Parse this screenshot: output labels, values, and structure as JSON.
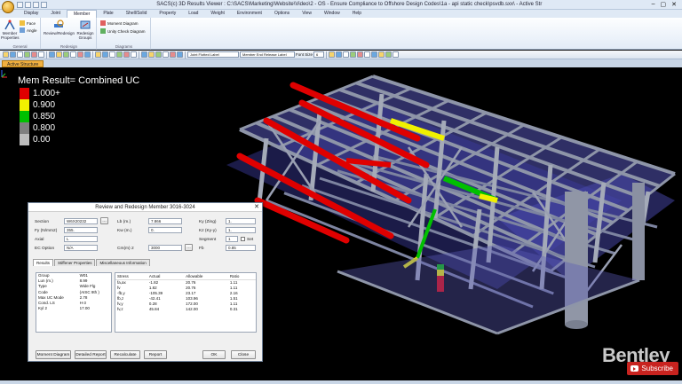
{
  "window": {
    "title": "SACS(c) 3D Results Viewer :  C:\\SACS\\Marketing\\Website\\Video\\2 - OS - Ensure Compliance to Offshore Design Codes\\1a - api static check\\psvdb.sxx\\ - Active Str",
    "controls": [
      "–",
      "▢",
      "✕"
    ]
  },
  "ribbon_tabs": [
    "Display",
    "Joint",
    "Member",
    "Plate",
    "Shell/Solid",
    "Property",
    "Load",
    "Weight",
    "Environment",
    "Options",
    "View",
    "Window",
    "Help"
  ],
  "ribbon_active_tab": "Member",
  "ribbon": {
    "general": {
      "label": "General",
      "member_properties": "Member Properties",
      "face": "Face",
      "angle": "Angle"
    },
    "redesign": {
      "label": "Redesign",
      "review_redesign": "Review/Redesign",
      "redesign_member": "Redesign Groups"
    },
    "diagrams": {
      "label": "Diagrams",
      "moment_diagram": "Moment Diagram",
      "unity_check_diagram": "Unity Check Diagram"
    }
  },
  "toolbar": {
    "dropdown1": "Joint Flotted Label",
    "dropdown2": "Member End Release Label",
    "font_label": "Font Size",
    "font_size": "6"
  },
  "doc_tab": "Active Structure",
  "legend": {
    "title": "Mem Result= Combined UC",
    "items": [
      {
        "label": "1.000+",
        "color": "#e00000"
      },
      {
        "label": "0.900",
        "color": "#f0f000"
      },
      {
        "label": "0.850",
        "color": "#00c000"
      },
      {
        "label": "0.800",
        "color": "#808080"
      },
      {
        "label": "0.00",
        "color": "#bdbdbd"
      }
    ]
  },
  "brand": {
    "name": "Bentley",
    "tag": "Advancing In"
  },
  "subscribe": "Subscribe",
  "dialog": {
    "title": "Review and Redesign Member 3016-3024",
    "close": "✕",
    "fields": {
      "section_label": "Section",
      "section_value": "W6X20232",
      "fy_label": "Fy (N/mm2)",
      "fy_value": "355.",
      "axial_label": "Axial",
      "axial_value": "L",
      "ec_option_label": "EC Option",
      "ec_option_value": "N/A",
      "lb_label": "Lb (m.)",
      "lb_value": "7.866",
      "kw_label": "Kw (m.)",
      "kw_value": "0.",
      "cm_label": "Cm(m) 2",
      "cm_value": "3000",
      "ky_label": "Ky (Zing)",
      "ky_value": "1.",
      "kz_label": "Kz (Ky-y)",
      "kz_value": "1.",
      "segment_label": "Segment",
      "segment_value": "1",
      "set_label": "Set",
      "fy2_label": "Fb",
      "fy2_value": "0.85"
    },
    "subtabs": [
      "Results",
      "Stiffener Properties",
      "Miscellaneous Information"
    ],
    "left_table": [
      [
        "Group",
        "W01"
      ],
      [
        "Lun (m.)",
        "8.99"
      ],
      [
        "Type",
        "Wide Flg"
      ],
      [
        "Code",
        "(AISC 9th )"
      ],
      [
        "Max UC Mode",
        "2.78"
      ],
      [
        "Cond. LS",
        "H-3"
      ],
      [
        "Kyl 2",
        "17.00"
      ]
    ],
    "right_headers": [
      "Stress",
      "Actual",
      "Allowable",
      "Ratio"
    ],
    "right_table": [
      [
        "fa,ax",
        "-1.82",
        "20.76",
        "1.11"
      ],
      [
        "fv",
        "1.82",
        "20.76",
        "1.11"
      ],
      [
        "-fb,y",
        "-105.39",
        "23.17",
        "2.16"
      ],
      [
        "fb,z",
        "-42.41",
        "103.96",
        "1.51"
      ],
      [
        "fv,y",
        "0.28",
        "172.00",
        "1.11"
      ],
      [
        "fv,z",
        "45.84",
        "142.00",
        "0.31"
      ]
    ],
    "buttons": {
      "moment_diagram": "Moment Diagram",
      "detailed_report": "Detailed Report",
      "recalculate": "Recalculate",
      "report": "Report",
      "ok": "OK",
      "close": "Close"
    }
  }
}
